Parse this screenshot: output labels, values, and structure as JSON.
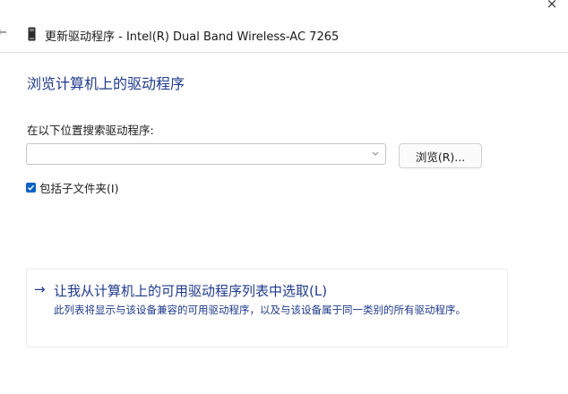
{
  "window": {
    "close_glyph": "×",
    "back_glyph": "←",
    "title": "更新驱动程序 - Intel(R) Dual Band Wireless-AC 7265",
    "title_icon": "device-icon"
  },
  "main": {
    "heading": "浏览计算机上的驱动程序",
    "location_label": "在以下位置搜索驱动程序:",
    "path_input": {
      "value": "",
      "placeholder": ""
    },
    "browse_button_label": "浏览(R)...",
    "include_subfolders": {
      "label": "包括子文件夹(I)",
      "checked": true
    },
    "pick_option": {
      "arrow": "→",
      "title": "让我从计算机上的可用驱动程序列表中选取(L)",
      "description": "此列表将显示与该设备兼容的可用驱动程序，以及与该设备属于同一类别的所有驱动程序。"
    }
  },
  "colors": {
    "accent": "#1f3a8a",
    "checkbox": "#0a62c4"
  }
}
